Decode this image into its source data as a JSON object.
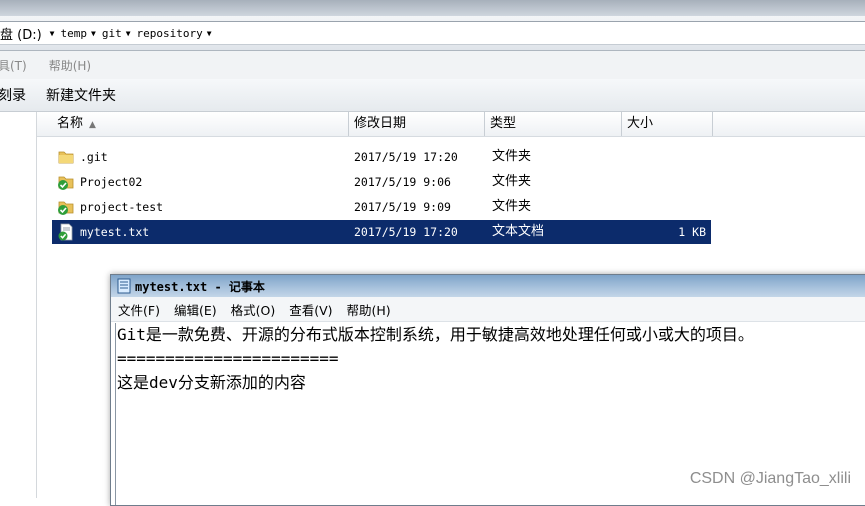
{
  "address": {
    "crumbs": [
      "盘 (D:)",
      "temp",
      "git",
      "repository"
    ]
  },
  "menubar": {
    "items": [
      "具(T)",
      "帮助(H)"
    ]
  },
  "toolbar": {
    "items": [
      "刻录",
      "新建文件夹"
    ]
  },
  "columns": {
    "name": "名称",
    "date": "修改日期",
    "type": "类型",
    "size": "大小"
  },
  "files": [
    {
      "name": ".git",
      "date": "2017/5/19 17:20",
      "type": "文件夹",
      "size": "",
      "icon": "folder-icon"
    },
    {
      "name": "Project02",
      "date": "2017/5/19 9:06",
      "type": "文件夹",
      "size": "",
      "icon": "git-folder-icon"
    },
    {
      "name": "project-test",
      "date": "2017/5/19 9:09",
      "type": "文件夹",
      "size": "",
      "icon": "git-folder-icon"
    },
    {
      "name": "mytest.txt",
      "date": "2017/5/19 17:20",
      "type": "文本文档",
      "size": "1 KB",
      "icon": "git-text-file-icon",
      "selected": true
    }
  ],
  "notepad": {
    "title": "mytest.txt - 记事本",
    "menu": [
      "文件(F)",
      "编辑(E)",
      "格式(O)",
      "查看(V)",
      "帮助(H)"
    ],
    "lines": [
      "Git是一款免费、开源的分布式版本控制系统，用于敏捷高效地处理任何或小或大的项目。",
      "",
      "=======================",
      "这是dev分支新添加的内容"
    ]
  },
  "watermark": "CSDN @JiangTao_xlili",
  "colors": {
    "selection": "#0c2b6b",
    "title_bar": "#8fb1d3"
  }
}
